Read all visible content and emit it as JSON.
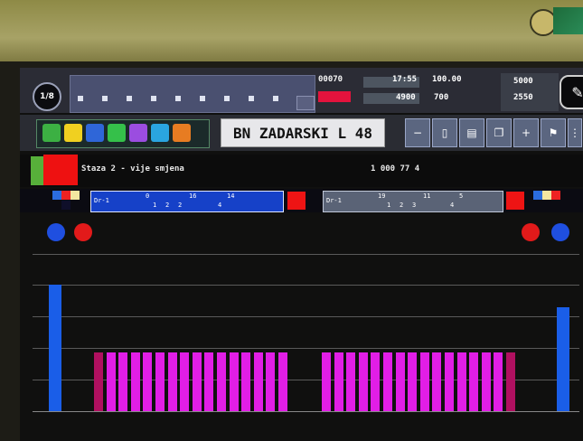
{
  "toolbar": {
    "page_indicator": "1/8",
    "station_title": "BN ZADARSKI L 48",
    "stats": [
      "00070",
      "17:55",
      "100.00",
      "5000",
      "4900",
      "700",
      "2550"
    ],
    "icons": [
      "tools-icon",
      "nav-icon"
    ]
  },
  "info": {
    "route": "Staza 2 - vije smjena",
    "speed": "1 000 77 4"
  },
  "track": {
    "left_label": "Dr-1",
    "left_values": [
      "0",
      "16",
      "14",
      "1",
      "2",
      "2",
      "4"
    ],
    "right_label": "Dr-1",
    "right_values": [
      "19",
      "11",
      "5",
      "1",
      "2",
      "3",
      "4"
    ]
  },
  "meters": {
    "left_count": 16,
    "right_count": 16
  },
  "colors": {
    "bar": "#e11ee6",
    "bar_edge": "#b01060",
    "volume": "#1a5ee8",
    "alarm": "#ee1111",
    "lamp_blue": "#1f4fe0",
    "lamp_red": "#e21a1a"
  }
}
